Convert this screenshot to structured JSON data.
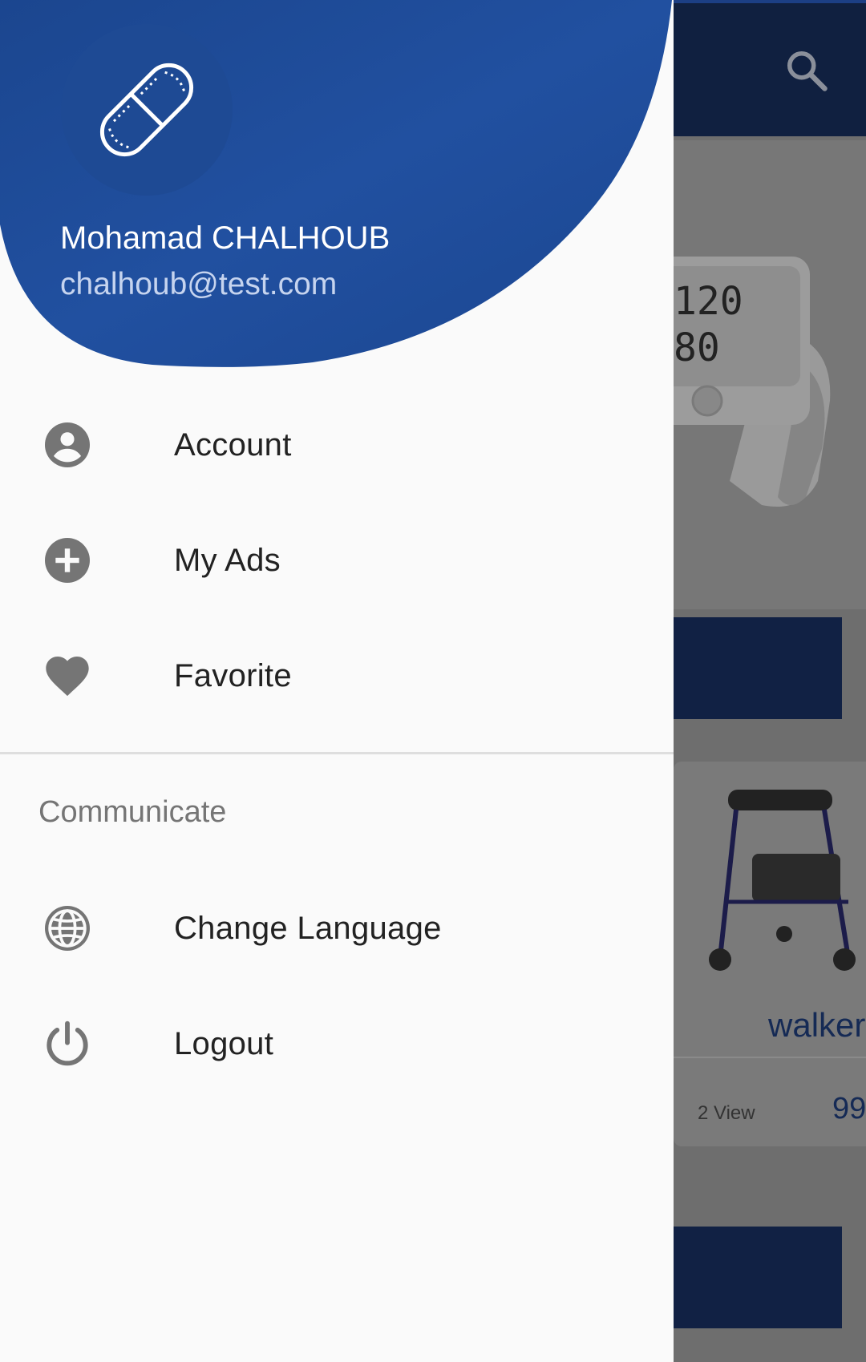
{
  "user": {
    "name": "Mohamad CHALHOUB",
    "email": "chalhoub@test.com"
  },
  "menu": {
    "items": [
      {
        "label": "Account",
        "icon": "account-circle-icon"
      },
      {
        "label": "My Ads",
        "icon": "add-circle-icon"
      },
      {
        "label": "Favorite",
        "icon": "heart-icon"
      }
    ],
    "section_title": "Communicate",
    "communicate_items": [
      {
        "label": "Change Language",
        "icon": "globe-icon"
      },
      {
        "label": "Logout",
        "icon": "power-icon"
      }
    ]
  },
  "background": {
    "card": {
      "title": "walker",
      "views": "2 View",
      "price": "99"
    }
  },
  "colors": {
    "header_blue": "#1f4e9c",
    "toolbar_dark": "#102040",
    "icon_gray": "#757575"
  }
}
